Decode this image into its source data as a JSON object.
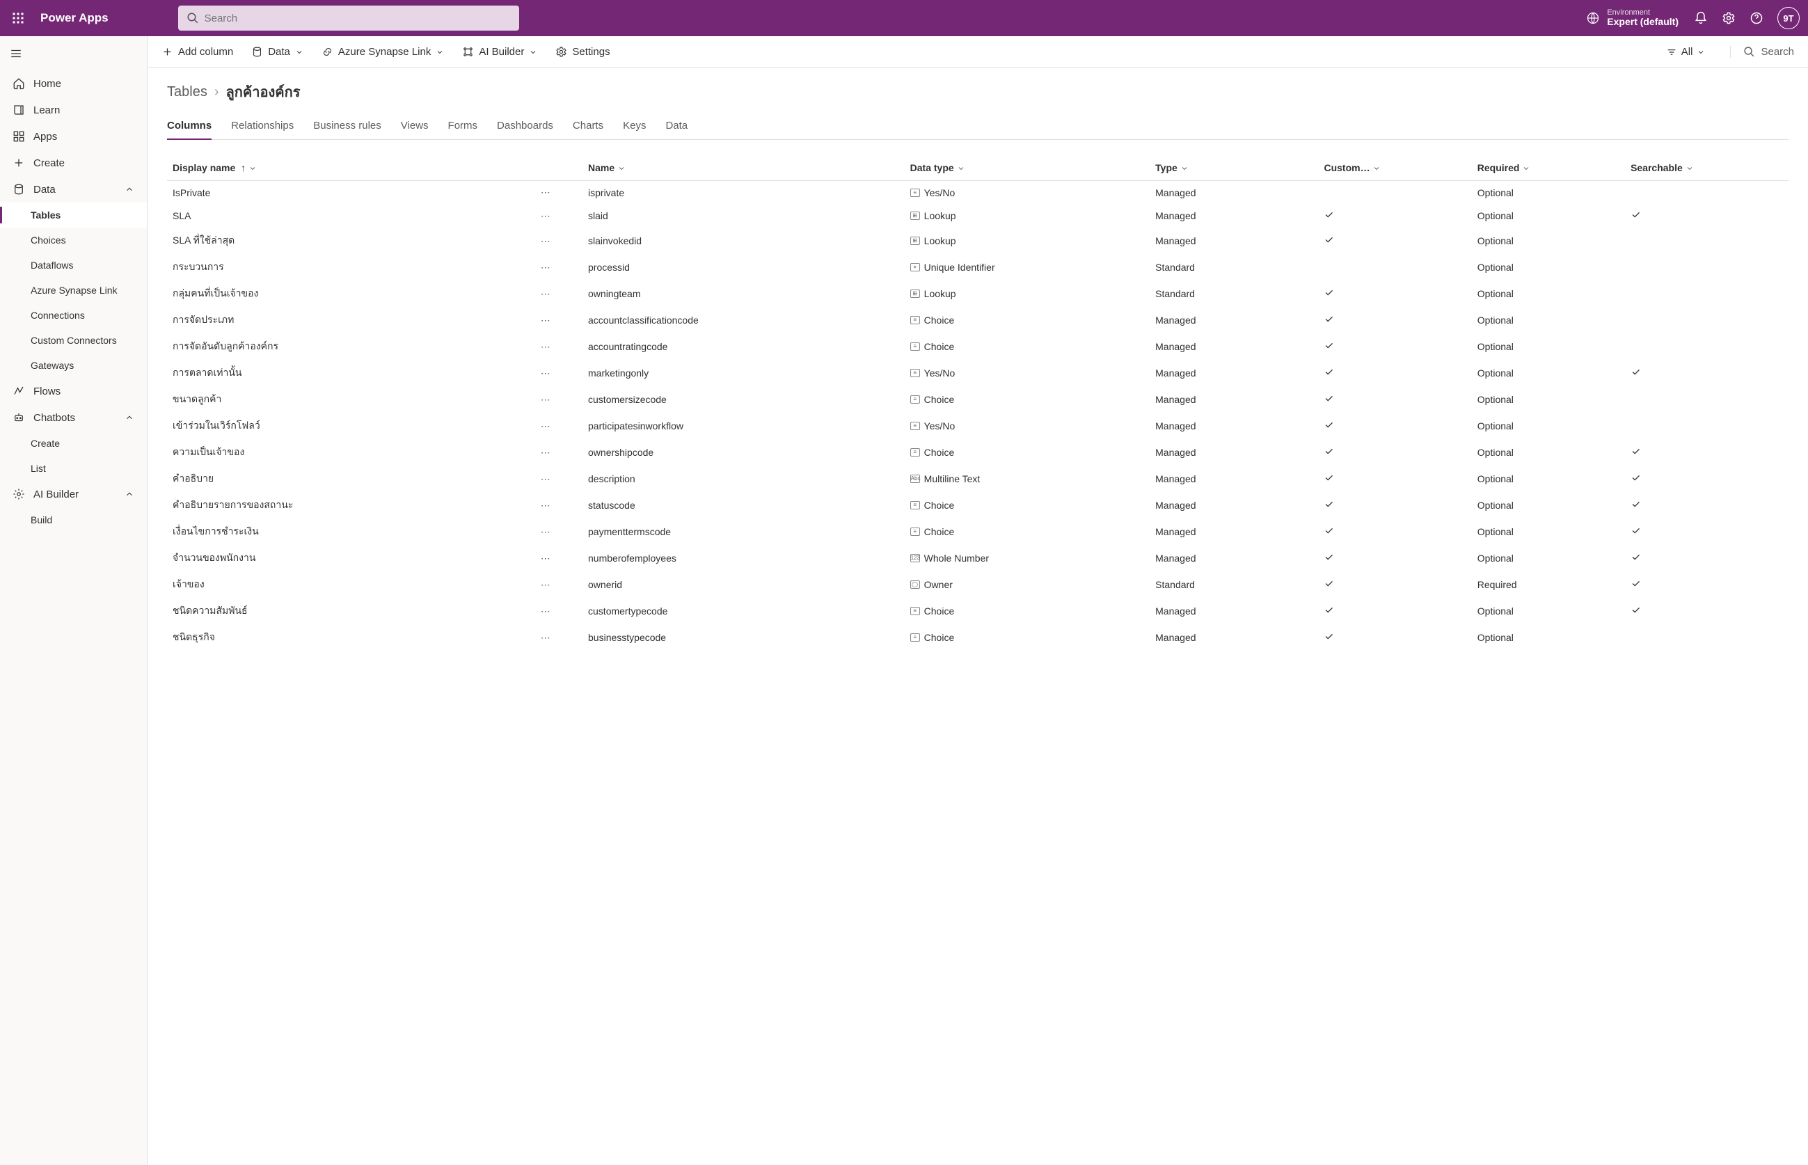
{
  "brand": "Power Apps",
  "search_placeholder": "Search",
  "environment_label": "Environment",
  "environment_name": "Expert (default)",
  "avatar": "9T",
  "sidebar": {
    "items": [
      {
        "icon": "home",
        "label": "Home"
      },
      {
        "icon": "book",
        "label": "Learn"
      },
      {
        "icon": "grid",
        "label": "Apps"
      },
      {
        "icon": "plus",
        "label": "Create"
      },
      {
        "icon": "db",
        "label": "Data",
        "expandable": true,
        "expanded": true,
        "children": [
          {
            "label": "Tables",
            "active": true
          },
          {
            "label": "Choices"
          },
          {
            "label": "Dataflows"
          },
          {
            "label": "Azure Synapse Link"
          },
          {
            "label": "Connections"
          },
          {
            "label": "Custom Connectors"
          },
          {
            "label": "Gateways"
          }
        ]
      },
      {
        "icon": "flow",
        "label": "Flows"
      },
      {
        "icon": "bot",
        "label": "Chatbots",
        "expandable": true,
        "expanded": true,
        "children": [
          {
            "label": "Create"
          },
          {
            "label": "List"
          }
        ]
      },
      {
        "icon": "ai",
        "label": "AI Builder",
        "expandable": true,
        "expanded": true,
        "children": [
          {
            "label": "Build"
          }
        ]
      }
    ]
  },
  "toolbar": {
    "add_column": "Add column",
    "data": "Data",
    "synapse": "Azure Synapse Link",
    "ai_builder": "AI Builder",
    "settings": "Settings",
    "filter": "All",
    "search": "Search"
  },
  "breadcrumb": {
    "root": "Tables",
    "leaf": "ลูกค้าองค์กร"
  },
  "tabs": [
    "Columns",
    "Relationships",
    "Business rules",
    "Views",
    "Forms",
    "Dashboards",
    "Charts",
    "Keys",
    "Data"
  ],
  "active_tab": 0,
  "columns_header": {
    "display_name": "Display name",
    "name": "Name",
    "data_type": "Data type",
    "type": "Type",
    "custom": "Custom…",
    "required": "Required",
    "searchable": "Searchable"
  },
  "rows": [
    {
      "display": "IsPrivate",
      "name": "isprivate",
      "data_type": "Yes/No",
      "type": "Managed",
      "custom": false,
      "required": "Optional",
      "searchable": false
    },
    {
      "display": "SLA",
      "name": "slaid",
      "data_type": "Lookup",
      "type": "Managed",
      "custom": true,
      "required": "Optional",
      "searchable": true
    },
    {
      "display": "SLA ที่ใช้ล่าสุด",
      "name": "slainvokedid",
      "data_type": "Lookup",
      "type": "Managed",
      "custom": true,
      "required": "Optional",
      "searchable": false
    },
    {
      "display": "กระบวนการ",
      "name": "processid",
      "data_type": "Unique Identifier",
      "type": "Standard",
      "custom": false,
      "required": "Optional",
      "searchable": false
    },
    {
      "display": "กลุ่มคนที่เป็นเจ้าของ",
      "name": "owningteam",
      "data_type": "Lookup",
      "type": "Standard",
      "custom": true,
      "required": "Optional",
      "searchable": false
    },
    {
      "display": "การจัดประเภท",
      "name": "accountclassificationcode",
      "data_type": "Choice",
      "type": "Managed",
      "custom": true,
      "required": "Optional",
      "searchable": false
    },
    {
      "display": "การจัดอันดับลูกค้าองค์กร",
      "name": "accountratingcode",
      "data_type": "Choice",
      "type": "Managed",
      "custom": true,
      "required": "Optional",
      "searchable": false
    },
    {
      "display": "การตลาดเท่านั้น",
      "name": "marketingonly",
      "data_type": "Yes/No",
      "type": "Managed",
      "custom": true,
      "required": "Optional",
      "searchable": true
    },
    {
      "display": "ขนาดลูกค้า",
      "name": "customersizecode",
      "data_type": "Choice",
      "type": "Managed",
      "custom": true,
      "required": "Optional",
      "searchable": false
    },
    {
      "display": "เข้าร่วมในเวิร์กโฟลว์",
      "name": "participatesinworkflow",
      "data_type": "Yes/No",
      "type": "Managed",
      "custom": true,
      "required": "Optional",
      "searchable": false
    },
    {
      "display": "ความเป็นเจ้าของ",
      "name": "ownershipcode",
      "data_type": "Choice",
      "type": "Managed",
      "custom": true,
      "required": "Optional",
      "searchable": true
    },
    {
      "display": "คำอธิบาย",
      "name": "description",
      "data_type": "Multiline Text",
      "type": "Managed",
      "custom": true,
      "required": "Optional",
      "searchable": true
    },
    {
      "display": "คำอธิบายรายการของสถานะ",
      "name": "statuscode",
      "data_type": "Choice",
      "type": "Managed",
      "custom": true,
      "required": "Optional",
      "searchable": true
    },
    {
      "display": "เงื่อนไขการชำระเงิน",
      "name": "paymenttermscode",
      "data_type": "Choice",
      "type": "Managed",
      "custom": true,
      "required": "Optional",
      "searchable": true
    },
    {
      "display": "จำนวนของพนักงาน",
      "name": "numberofemployees",
      "data_type": "Whole Number",
      "type": "Managed",
      "custom": true,
      "required": "Optional",
      "searchable": true
    },
    {
      "display": "เจ้าของ",
      "name": "ownerid",
      "data_type": "Owner",
      "type": "Standard",
      "custom": true,
      "required": "Required",
      "searchable": true
    },
    {
      "display": "ชนิดความสัมพันธ์",
      "name": "customertypecode",
      "data_type": "Choice",
      "type": "Managed",
      "custom": true,
      "required": "Optional",
      "searchable": true
    },
    {
      "display": "ชนิดธุรกิจ",
      "name": "businesstypecode",
      "data_type": "Choice",
      "type": "Managed",
      "custom": true,
      "required": "Optional",
      "searchable": false
    }
  ]
}
